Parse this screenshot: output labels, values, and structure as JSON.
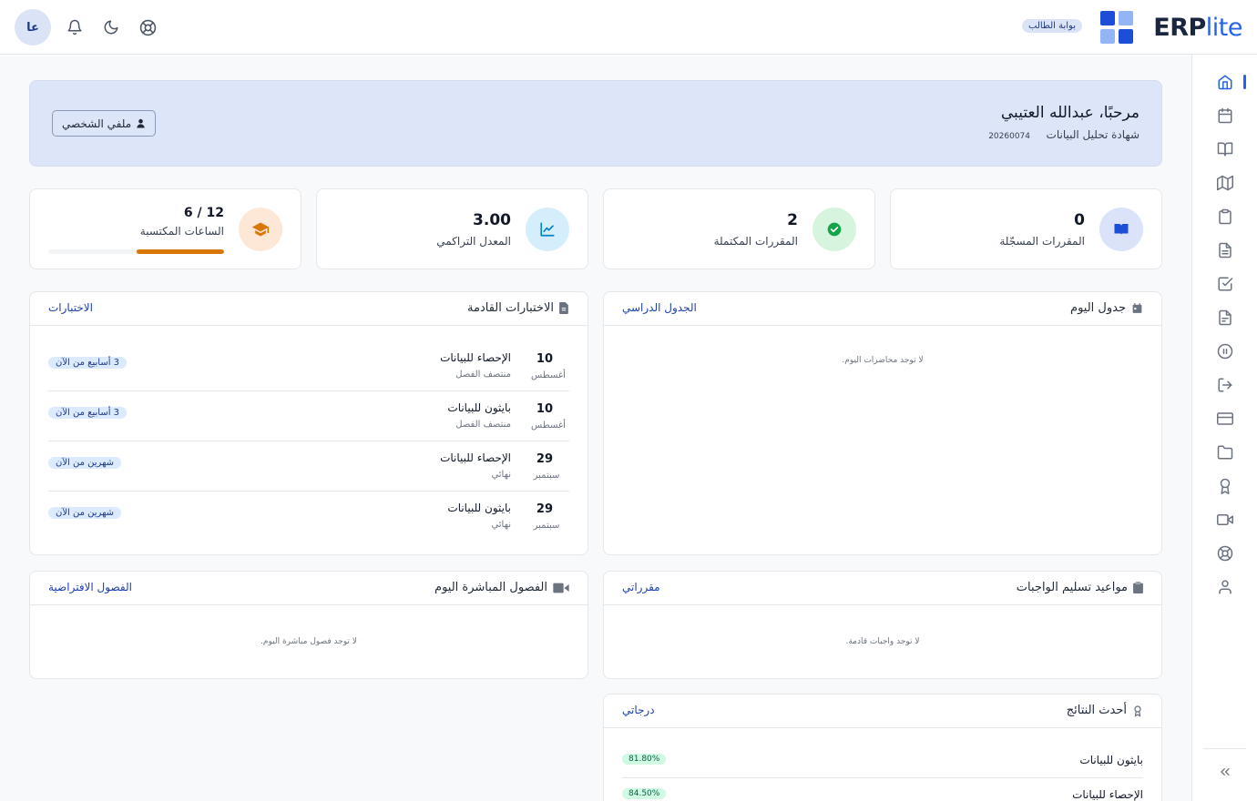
{
  "topbar": {
    "avatar_initials": "عا",
    "portal_badge": "بوابة الطالب",
    "logo_erp": "ERP",
    "logo_lite": "lite",
    "icons": [
      "bell-icon",
      "moon-icon",
      "help-lifebuoy-icon"
    ]
  },
  "colors": {
    "primary": "#2563eb",
    "logo_dark": "#1d4ed8",
    "logo_light": "#93b4f5",
    "banner_bg": "#dde5f9",
    "orange": "#d97706",
    "green": "#16a34a"
  },
  "sidebar": {
    "items": [
      "home-icon",
      "calendar-icon",
      "book-open-icon",
      "map-icon",
      "clipboard-icon",
      "file-text-icon",
      "check-square-icon",
      "document-icon",
      "pause-circle-icon",
      "logout-icon",
      "credit-card-icon",
      "folder-icon",
      "award-icon",
      "video-icon",
      "lifebuoy-icon",
      "user-icon"
    ],
    "collapse_icon": "chevrons-left-icon"
  },
  "welcome": {
    "greeting": "مرحبًا، عبدالله العتيبي",
    "program": "شهادة تحليل البيانات",
    "student_id": "20260074",
    "profile_button": "ملفي الشخصي"
  },
  "stats": [
    {
      "value": "0",
      "label": "المقررات المسجّلة",
      "icon": "book-icon"
    },
    {
      "value": "2",
      "label": "المقررات المكتملة",
      "icon": "check-circle-icon"
    },
    {
      "value": "3.00",
      "label": "المعدل التراكمي",
      "icon": "chart-line-icon"
    },
    {
      "value": "6 / 12",
      "label": "الساعات المكتسبة",
      "icon": "graduation-cap-icon",
      "progress": 0.5
    }
  ],
  "schedule": {
    "title": "جدول اليوم",
    "link": "الجدول الدراسي",
    "empty": "لا توجد محاضرات اليوم."
  },
  "exams": {
    "title": "الاختبارات القادمة",
    "link": "الاختبارات",
    "items": [
      {
        "day": "10",
        "month": "أغسطس",
        "name": "الإحصاء للبيانات",
        "type": "منتصف الفصل",
        "relative": "3 أسابيع من الآن"
      },
      {
        "day": "10",
        "month": "أغسطس",
        "name": "بايثون للبيانات",
        "type": "منتصف الفصل",
        "relative": "3 أسابيع من الآن"
      },
      {
        "day": "29",
        "month": "سبتمبر",
        "name": "الإحصاء للبيانات",
        "type": "نهائي",
        "relative": "شهرين من الآن"
      },
      {
        "day": "29",
        "month": "سبتمبر",
        "name": "بايثون للبيانات",
        "type": "نهائي",
        "relative": "شهرين من الآن"
      }
    ]
  },
  "assignments": {
    "title": "مواعيد تسليم الواجبات",
    "link": "مقرراتي",
    "empty": "لا توجد واجبات قادمة."
  },
  "live": {
    "title": "الفصول المباشرة اليوم",
    "link": "الفصول الافتراضية",
    "empty": "لا توجد فصول مباشرة اليوم."
  },
  "results": {
    "title": "أحدث النتائج",
    "link": "درجاتي",
    "items": [
      {
        "course": "بايثون للبيانات",
        "score": "81.80%"
      },
      {
        "course": "الإحصاء للبيانات",
        "score": "84.50%"
      }
    ]
  }
}
